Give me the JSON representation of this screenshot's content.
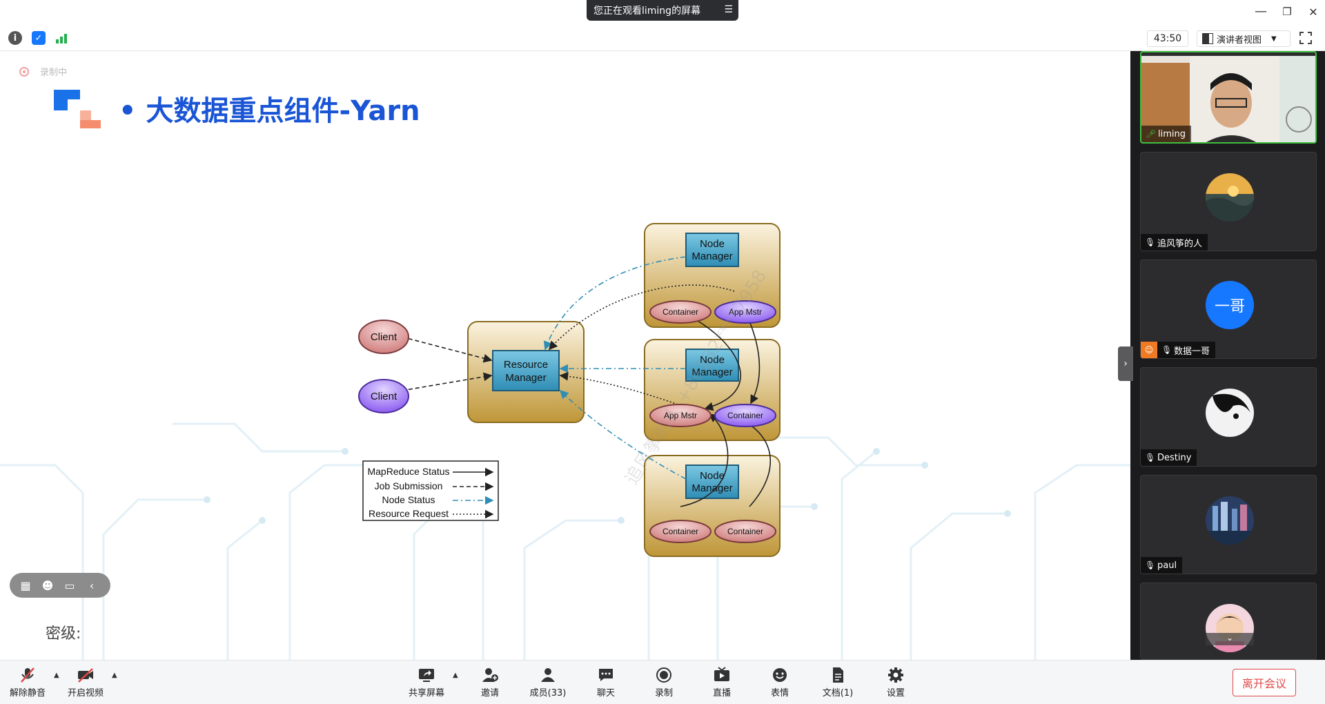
{
  "titlebar": {
    "share_banner": "您正在观看liming的屏幕",
    "menu_icon": "list-icon",
    "minimize": "—",
    "restore": "❐",
    "close": "✕"
  },
  "toprow": {
    "info_icon": "info-icon",
    "shield_icon": "shield-icon",
    "signal_icon": "signal-icon",
    "timer": "43:50",
    "view_mode": "演讲者视图",
    "fullscreen_icon": "fullscreen-icon"
  },
  "slide": {
    "recording": "录制中",
    "title": "• 大数据重点组件-Yarn",
    "secret_label": "密级:",
    "watermark": "追风筝的人 +86132****7958"
  },
  "diagram": {
    "client1": "Client",
    "client2": "Client",
    "rm_line1": "Resource",
    "rm_line2": "Manager",
    "nm_line1": "Node",
    "nm_line2": "Manager",
    "container": "Container",
    "app_mstr": "App Mstr",
    "legend": [
      "MapReduce Status",
      "Job Submission",
      "Node Status",
      "Resource Request"
    ]
  },
  "participants": [
    {
      "name": "liming",
      "type": "video"
    },
    {
      "name": "追风筝的人",
      "type": "image"
    },
    {
      "name": "数据一哥",
      "type": "initials",
      "initials": "一哥",
      "color": "#1677ff"
    },
    {
      "name": "Destiny",
      "type": "image"
    },
    {
      "name": "paul",
      "type": "image"
    },
    {
      "name": "",
      "type": "image"
    }
  ],
  "bottombar": {
    "mute": "解除静音",
    "video": "开启视频",
    "share": "共享屏幕",
    "invite": "邀请",
    "members": "成员(33)",
    "chat": "聊天",
    "record": "录制",
    "live": "直播",
    "emoji": "表情",
    "docs": "文档(1)",
    "settings": "设置",
    "leave": "离开会议"
  },
  "colors": {
    "accent": "#1a55d6",
    "leave": "#e04848",
    "node_box": "#c9a24a",
    "rm_blue": "#3ba2c8"
  }
}
